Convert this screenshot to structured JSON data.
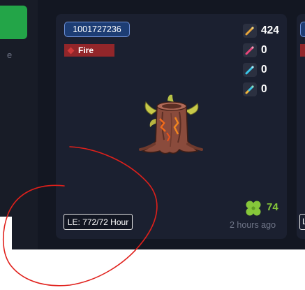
{
  "sidebar": {
    "partial_text": "e"
  },
  "card": {
    "id": "1001727236",
    "element": "Fire",
    "stats": [
      {
        "icon": "orange-potion-icon",
        "value": "424",
        "color": "#e8a53a"
      },
      {
        "icon": "pink-potion-icon",
        "value": "0",
        "color": "#e8457a"
      },
      {
        "icon": "cyan-potion-icon",
        "value": "0",
        "color": "#3ac6e8"
      },
      {
        "icon": "rainbow-potion-icon",
        "value": "0",
        "color": "#8be0c0"
      }
    ],
    "le_label": "LE: 772/72 Hour",
    "clover_value": "74",
    "time_ago": "2 hours ago"
  },
  "next_card": {
    "partial_le": "L"
  },
  "colors": {
    "background": "#131722",
    "card": "#1b2030",
    "fire": "#92262a",
    "id_badge": "#1d3d74",
    "clover": "#86c73a",
    "annotation": "#e0201b"
  }
}
